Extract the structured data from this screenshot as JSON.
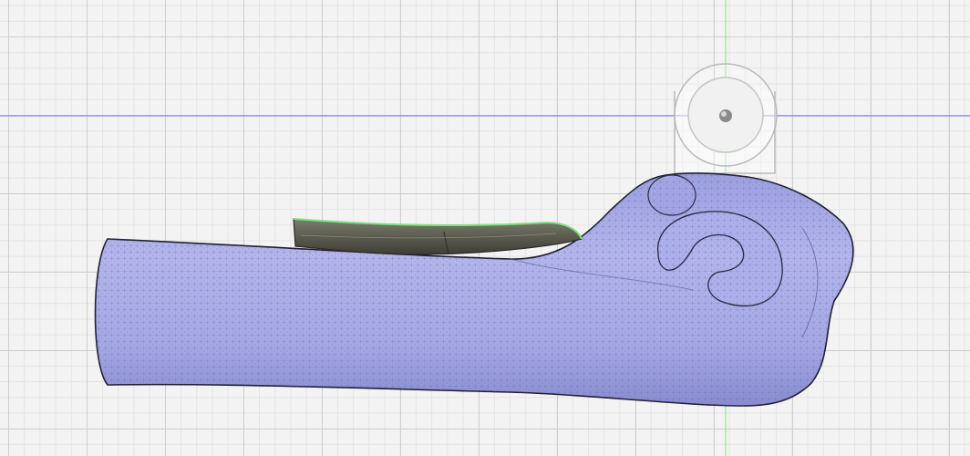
{
  "viewport": {
    "background_color": "#f3f3f3",
    "grid_major_color": "#cfcfcf",
    "grid_minor_color": "#e4e4e4"
  },
  "axes": {
    "vertical_axis_color": "#7ee07e",
    "horizontal_axis_color": "#7a7ad8"
  },
  "model": {
    "arm_mesh_color": "#a9abe6",
    "splint_color": "#5e5e52",
    "splint_edge_color": "#7de27d",
    "gizmo_color": "#c8c8c8",
    "gizmo_icon": "rotate-ring-icon"
  }
}
